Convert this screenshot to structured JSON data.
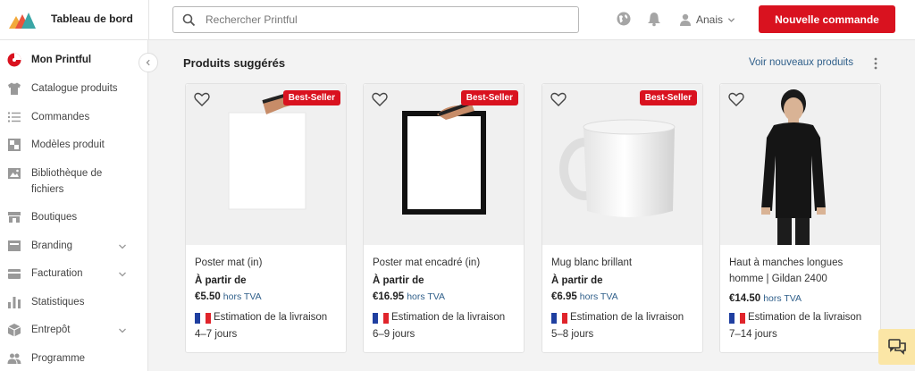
{
  "header": {
    "title": "Tableau de bord",
    "search_placeholder": "Rechercher Printful",
    "user_name": "Anais",
    "new_order_label": "Nouvelle commande"
  },
  "sidebar": {
    "items": [
      {
        "label": "Mon Printful",
        "icon": "printful-logo-icon",
        "active": true
      },
      {
        "label": "Catalogue produits",
        "icon": "tshirt-icon"
      },
      {
        "label": "Commandes",
        "icon": "list-icon"
      },
      {
        "label": "Modèles produit",
        "icon": "template-icon"
      },
      {
        "label": "Bibliothèque de fichiers",
        "icon": "image-library-icon"
      },
      {
        "label": "Boutiques",
        "icon": "store-icon"
      },
      {
        "label": "Branding",
        "icon": "branding-icon",
        "expandable": true
      },
      {
        "label": "Facturation",
        "icon": "credit-card-icon",
        "expandable": true
      },
      {
        "label": "Statistiques",
        "icon": "bar-chart-icon"
      },
      {
        "label": "Entrepôt",
        "icon": "box-icon",
        "expandable": true
      },
      {
        "label": "Programme",
        "icon": "people-icon"
      }
    ]
  },
  "main": {
    "section_title": "Produits suggérés",
    "see_more_link": "Voir nouveaux produits",
    "products": [
      {
        "name": "Poster mat (in)",
        "badge": "Best-Seller",
        "from_label": "À partir de",
        "price": "€5.50",
        "tax_label": "hors TVA",
        "shipping_label": "Estimation de la livraison",
        "shipping_days": "4–7 jours"
      },
      {
        "name": "Poster mat encadré (in)",
        "badge": "Best-Seller",
        "from_label": "À partir de",
        "price": "€16.95",
        "tax_label": "hors TVA",
        "shipping_label": "Estimation de la livraison",
        "shipping_days": "6–9 jours"
      },
      {
        "name": "Mug blanc brillant",
        "badge": "Best-Seller",
        "from_label": "À partir de",
        "price": "€6.95",
        "tax_label": "hors TVA",
        "shipping_label": "Estimation de la livraison",
        "shipping_days": "5–8 jours"
      },
      {
        "name": "Haut à manches longues homme | Gildan 2400",
        "badge": "",
        "from_label": "",
        "price": "€14.50",
        "tax_label": "hors TVA",
        "shipping_label": "Estimation de la livraison",
        "shipping_days": "7–14 jours"
      }
    ]
  },
  "colors": {
    "accent_red": "#d9121f",
    "link_blue": "#2f5f8a",
    "chat_yellow": "#fbe6a6"
  }
}
